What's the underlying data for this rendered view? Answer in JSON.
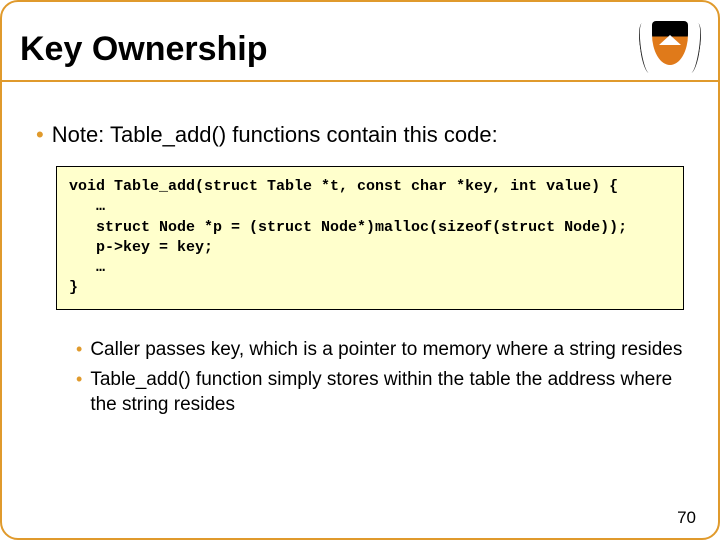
{
  "title": "Key Ownership",
  "note_bullet": "Note: Table_add() functions contain this code:",
  "code": "void Table_add(struct Table *t, const char *key, int value) {\n   …\n   struct Node *p = (struct Node*)malloc(sizeof(struct Node));\n   p->key = key;\n   …\n}",
  "sub_bullets": [
    "Caller passes key, which is a pointer to memory where a string resides",
    "Table_add() function simply stores within the table the address where the string resides"
  ],
  "page_number": "70"
}
